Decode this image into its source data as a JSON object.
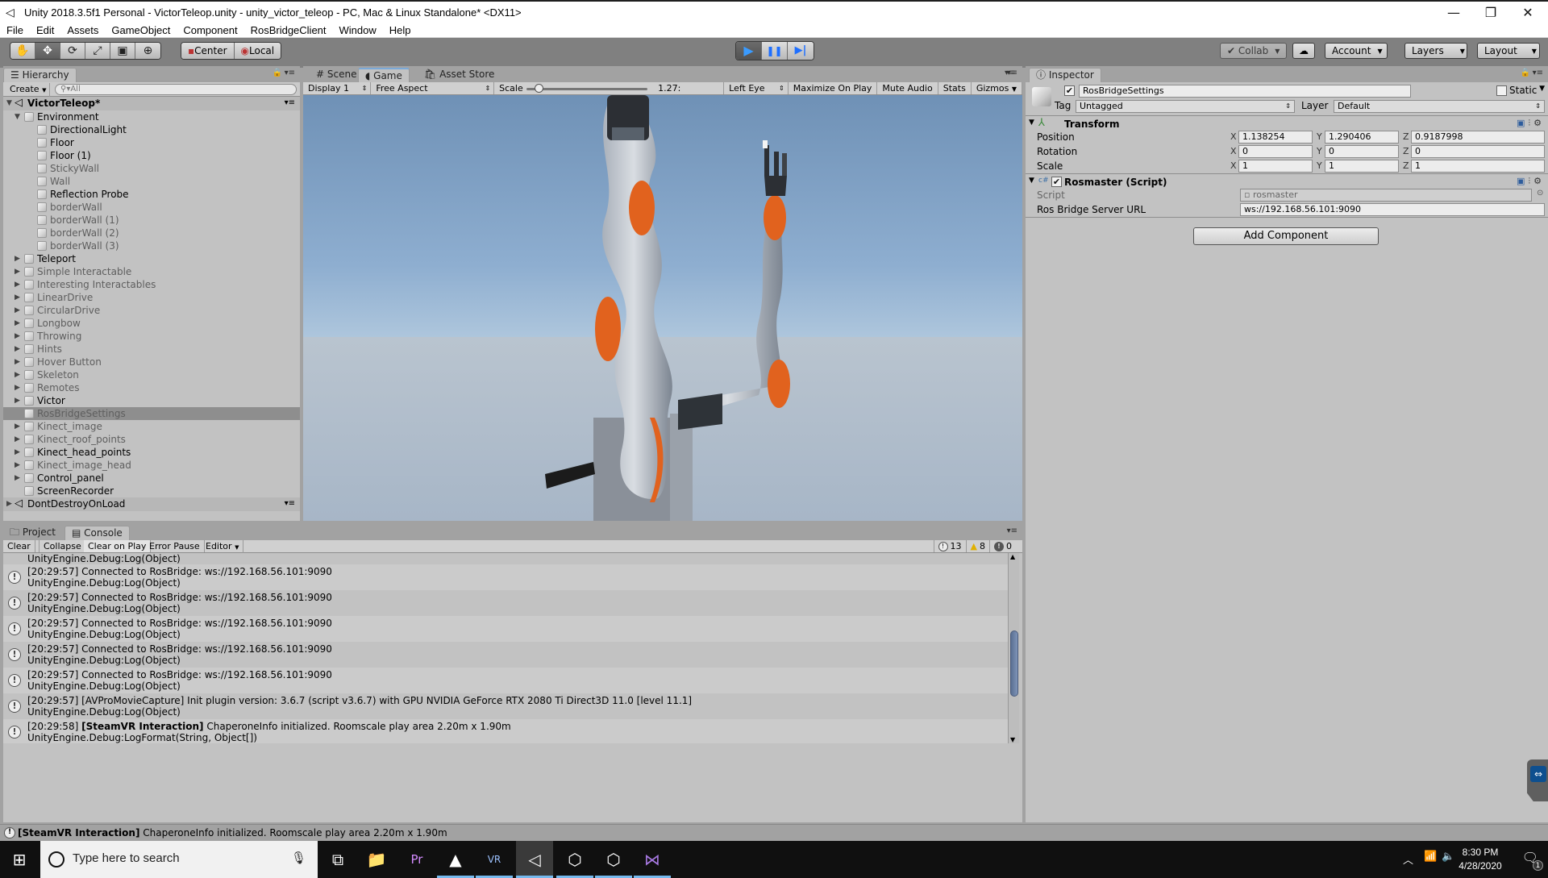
{
  "window": {
    "title": "Unity 2018.3.5f1 Personal - VictorTeleop.unity - unity_victor_teleop - PC, Mac & Linux Standalone* <DX11>",
    "minimize": "—",
    "restore": "❐",
    "close": "✕"
  },
  "menu": [
    "File",
    "Edit",
    "Assets",
    "GameObject",
    "Component",
    "RosBridgeClient",
    "Window",
    "Help"
  ],
  "toolbar": {
    "tools": [
      "hand-tool",
      "move-tool",
      "rotate-tool",
      "scale-tool",
      "rect-tool",
      "transform-tool"
    ],
    "tool_glyphs": [
      "✋",
      "✥",
      "⟳",
      "⤢",
      "▣",
      "⊕"
    ],
    "pivot": "Center",
    "space": "Local",
    "play_glyph": "▶",
    "pause_glyph": "❚❚",
    "step_glyph": "▶|",
    "collab": "Collab",
    "account": "Account",
    "layers": "Layers",
    "layout": "Layout"
  },
  "hierarchy": {
    "tab": "Hierarchy",
    "create": "Create",
    "search_placeholder": "All",
    "scene": "VictorTeleop*",
    "items": [
      {
        "label": "Environment",
        "depth": 1,
        "expand": "open",
        "active": true
      },
      {
        "label": "DirectionalLight",
        "depth": 2,
        "expand": "none",
        "active": true
      },
      {
        "label": "Floor",
        "depth": 2,
        "expand": "none",
        "active": true
      },
      {
        "label": "Floor (1)",
        "depth": 2,
        "expand": "none",
        "active": true
      },
      {
        "label": "StickyWall",
        "depth": 2,
        "expand": "none",
        "active": false
      },
      {
        "label": "Wall",
        "depth": 2,
        "expand": "none",
        "active": false
      },
      {
        "label": "Reflection Probe",
        "depth": 2,
        "expand": "none",
        "active": true
      },
      {
        "label": "borderWall",
        "depth": 2,
        "expand": "none",
        "active": false
      },
      {
        "label": "borderWall (1)",
        "depth": 2,
        "expand": "none",
        "active": false
      },
      {
        "label": "borderWall (2)",
        "depth": 2,
        "expand": "none",
        "active": false
      },
      {
        "label": "borderWall (3)",
        "depth": 2,
        "expand": "none",
        "active": false
      },
      {
        "label": "Teleport",
        "depth": 1,
        "expand": "closed",
        "active": true
      },
      {
        "label": "Simple Interactable",
        "depth": 1,
        "expand": "closed",
        "active": false
      },
      {
        "label": "Interesting Interactables",
        "depth": 1,
        "expand": "closed",
        "active": false
      },
      {
        "label": "LinearDrive",
        "depth": 1,
        "expand": "closed",
        "active": false
      },
      {
        "label": "CircularDrive",
        "depth": 1,
        "expand": "closed",
        "active": false
      },
      {
        "label": "Longbow",
        "depth": 1,
        "expand": "closed",
        "active": false
      },
      {
        "label": "Throwing",
        "depth": 1,
        "expand": "closed",
        "active": false
      },
      {
        "label": "Hints",
        "depth": 1,
        "expand": "closed",
        "active": false
      },
      {
        "label": "Hover Button",
        "depth": 1,
        "expand": "closed",
        "active": false
      },
      {
        "label": "Skeleton",
        "depth": 1,
        "expand": "closed",
        "active": false
      },
      {
        "label": "Remotes",
        "depth": 1,
        "expand": "closed",
        "active": false
      },
      {
        "label": "Victor",
        "depth": 1,
        "expand": "closed",
        "active": true
      },
      {
        "label": "RosBridgeSettings",
        "depth": 1,
        "expand": "none",
        "active": false,
        "selected": true
      },
      {
        "label": "Kinect_image",
        "depth": 1,
        "expand": "closed",
        "active": false
      },
      {
        "label": "Kinect_roof_points",
        "depth": 1,
        "expand": "closed",
        "active": false
      },
      {
        "label": "Kinect_head_points",
        "depth": 1,
        "expand": "closed",
        "active": true
      },
      {
        "label": "Kinect_image_head",
        "depth": 1,
        "expand": "closed",
        "active": false
      },
      {
        "label": "Control_panel",
        "depth": 1,
        "expand": "closed",
        "active": true
      },
      {
        "label": "ScreenRecorder",
        "depth": 1,
        "expand": "none",
        "active": true
      }
    ],
    "scene2": "DontDestroyOnLoad"
  },
  "game": {
    "tabs": [
      "Scene",
      "Game",
      "Asset Store"
    ],
    "active_tab": "Game",
    "display": "Display 1",
    "aspect": "Free Aspect",
    "scale_label": "Scale",
    "scale_value": "1.27:",
    "scale_fraction": 0.1,
    "eye": "Left Eye",
    "maximize": "Maximize On Play",
    "mute": "Mute Audio",
    "stats": "Stats",
    "gizmos": "Gizmos"
  },
  "console": {
    "tabs": [
      "Project",
      "Console"
    ],
    "active_tab": "Console",
    "buttons": [
      "Clear",
      "Collapse",
      "Clear on Play",
      "Error Pause",
      "Editor"
    ],
    "info_count": "13",
    "warn_count": "8",
    "error_count": "0",
    "partial_top": "UnityEngine.Debug:Log(Object)",
    "logs": [
      {
        "line1": "[20:29:57] Connected to RosBridge: ws://192.168.56.101:9090",
        "line2": "UnityEngine.Debug:Log(Object)"
      },
      {
        "line1": "[20:29:57] Connected to RosBridge: ws://192.168.56.101:9090",
        "line2": "UnityEngine.Debug:Log(Object)"
      },
      {
        "line1": "[20:29:57] Connected to RosBridge: ws://192.168.56.101:9090",
        "line2": "UnityEngine.Debug:Log(Object)"
      },
      {
        "line1": "[20:29:57] Connected to RosBridge: ws://192.168.56.101:9090",
        "line2": "UnityEngine.Debug:Log(Object)"
      },
      {
        "line1": "[20:29:57] Connected to RosBridge: ws://192.168.56.101:9090",
        "line2": "UnityEngine.Debug:Log(Object)"
      },
      {
        "line1": "[20:29:57] [AVProMovieCapture] Init plugin version: 3.6.7 (script v3.6.7) with GPU NVIDIA GeForce RTX 2080 Ti Direct3D 11.0 [level 11.1]",
        "line2": "UnityEngine.Debug:Log(Object)"
      },
      {
        "line1_time": "[20:29:58] ",
        "line1_bold": "[SteamVR Interaction]",
        "line1_rest": " ChaperoneInfo initialized. Roomscale play area 2.20m x 1.90m",
        "line2": "UnityEngine.Debug:LogFormat(String, Object[])"
      }
    ],
    "scroll_fraction": 0.65
  },
  "status": {
    "bold": "[SteamVR Interaction]",
    "rest": " ChaperoneInfo initialized. Roomscale play area 2.20m x 1.90m"
  },
  "inspector": {
    "tab": "Inspector",
    "object_name": "RosBridgeSettings",
    "active": true,
    "static_label": "Static",
    "tag_label": "Tag",
    "tag_value": "Untagged",
    "layer_label": "Layer",
    "layer_value": "Default",
    "transform": {
      "title": "Transform",
      "rows": [
        {
          "label": "Position",
          "x": "1.138254",
          "y": "1.290406",
          "z": "0.9187998"
        },
        {
          "label": "Rotation",
          "x": "0",
          "y": "0",
          "z": "0"
        },
        {
          "label": "Scale",
          "x": "1",
          "y": "1",
          "z": "1"
        }
      ]
    },
    "script_comp": {
      "title": "Rosmaster (Script)",
      "script_label": "Script",
      "script_value": "rosmaster",
      "url_label": "Ros Bridge Server URL",
      "url_value": "ws://192.168.56.101:9090"
    },
    "add_component": "Add Component"
  },
  "taskbar": {
    "search_placeholder": "Type here to search",
    "apps": [
      {
        "name": "task-view",
        "glyph": "⧉"
      },
      {
        "name": "file-explorer",
        "glyph": "📁"
      },
      {
        "name": "premiere-pro",
        "glyph": "Pr"
      },
      {
        "name": "arduino-like-app",
        "glyph": "▲"
      },
      {
        "name": "steamvr",
        "glyph": "VR"
      },
      {
        "name": "unity",
        "glyph": "◁"
      },
      {
        "name": "virtualbox",
        "glyph": "⬡"
      },
      {
        "name": "virtualbox-2",
        "glyph": "⬡"
      },
      {
        "name": "visual-studio",
        "glyph": "⋈"
      }
    ],
    "time": "8:30 PM",
    "date": "4/28/2020",
    "notifications": "1"
  }
}
